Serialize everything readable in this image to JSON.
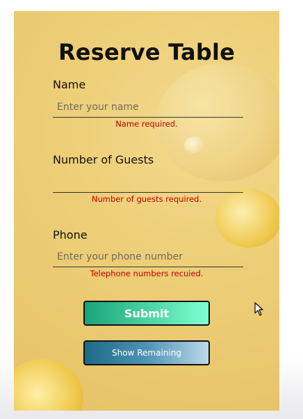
{
  "form": {
    "title": "Reserve Table",
    "name": {
      "label": "Name",
      "placeholder": "Enter your name",
      "value": "",
      "error": "Name required."
    },
    "guests": {
      "label": "Number of Guests",
      "placeholder": "",
      "value": "",
      "error": "Number of guests required."
    },
    "phone": {
      "label": "Phone",
      "placeholder": "Enter your phone number",
      "value": "",
      "error": "Telephone numbers recuied."
    },
    "submit_label": "Submit",
    "show_remaining_label": "Show Remaining"
  },
  "colors": {
    "panel_background": "#eed07a",
    "error_text": "#c40000",
    "submit_gradient": [
      "#1aa37a",
      "#7fffd4"
    ],
    "show_remaining_gradient": [
      "#1c6a86",
      "#bcd9ea"
    ]
  },
  "icons": {
    "cursor": "mouse-pointer-icon"
  }
}
